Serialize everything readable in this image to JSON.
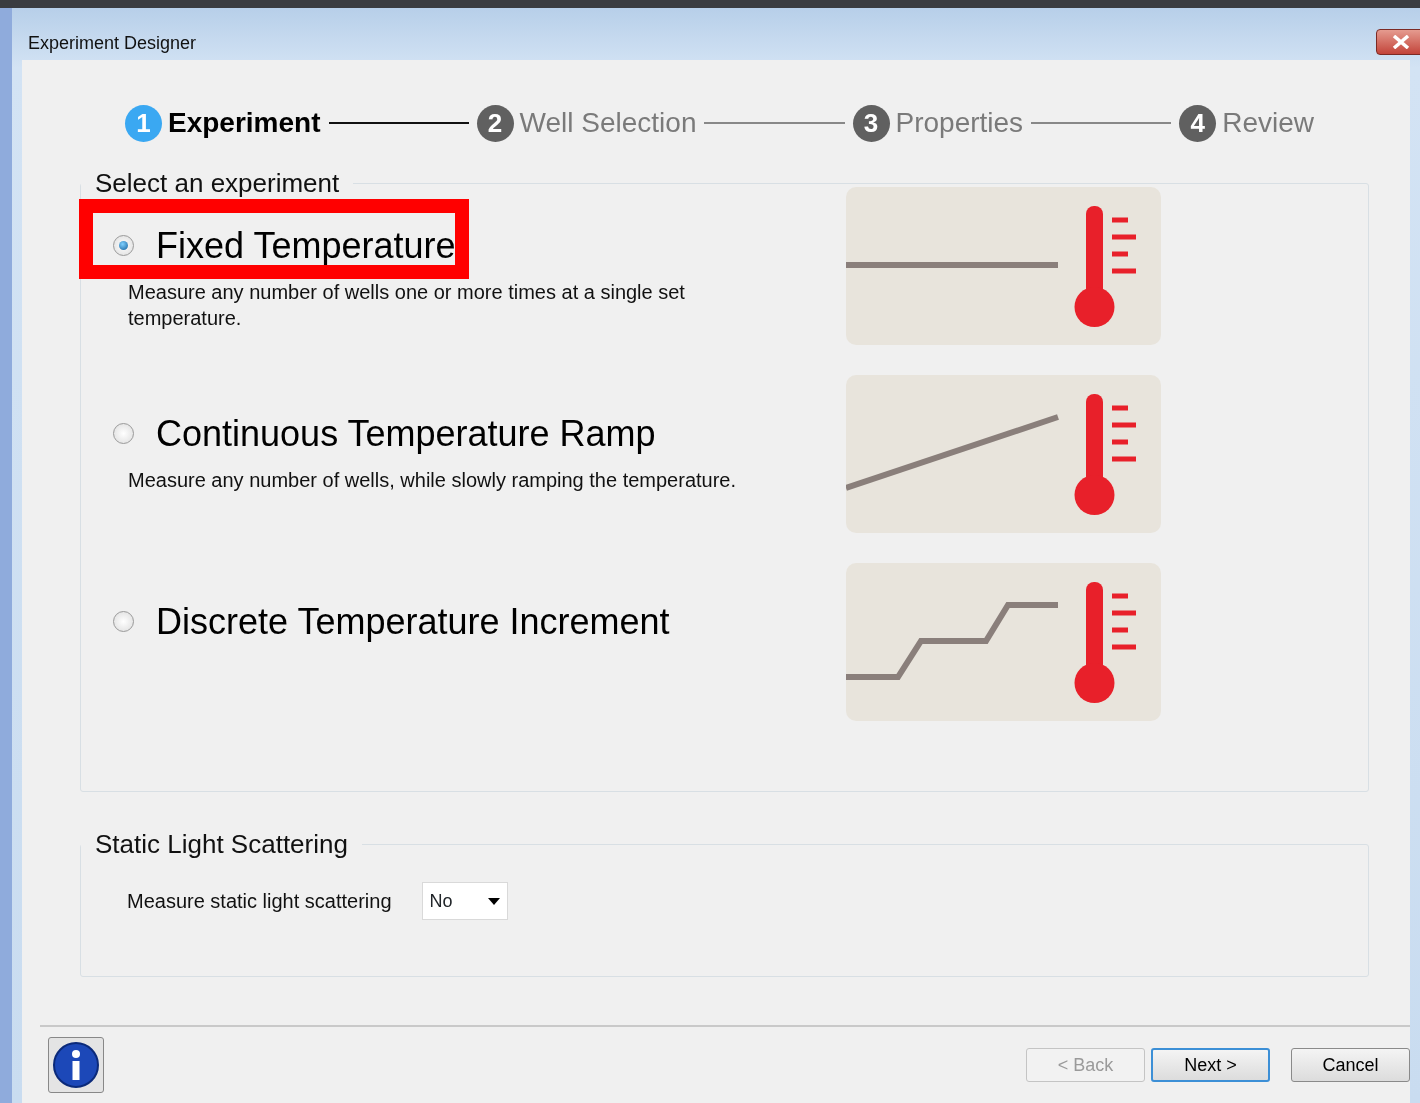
{
  "window": {
    "title": "Experiment Designer"
  },
  "steps": [
    {
      "number": "1",
      "label": "Experiment",
      "selected": true
    },
    {
      "number": "2",
      "label": "Well Selection",
      "selected": false
    },
    {
      "number": "3",
      "label": "Properties",
      "selected": false
    },
    {
      "number": "4",
      "label": "Review",
      "selected": false
    }
  ],
  "experiment_group": {
    "legend": "Select an experiment",
    "options": [
      {
        "name": "Fixed Temperature",
        "description": "Measure any number of wells one or more times at a single set temperature.",
        "selected": true,
        "highlighted": true,
        "kind": "flat"
      },
      {
        "name": "Continuous Temperature Ramp",
        "description": "Measure any number of wells, while slowly ramping the temperature.",
        "selected": false,
        "highlighted": false,
        "kind": "ramp"
      },
      {
        "name": "Discrete Temperature Increment",
        "selected": false,
        "highlighted": false,
        "kind": "steps"
      }
    ]
  },
  "sls_group": {
    "legend": "Static Light Scattering",
    "label": "Measure static light scattering",
    "value": "No"
  },
  "buttons": [
    {
      "label": "< Back",
      "kind": "back",
      "disabled": true
    },
    {
      "label": "Next >",
      "kind": "next",
      "disabled": false
    },
    {
      "label": "Cancel",
      "kind": "cancel",
      "disabled": false
    }
  ]
}
